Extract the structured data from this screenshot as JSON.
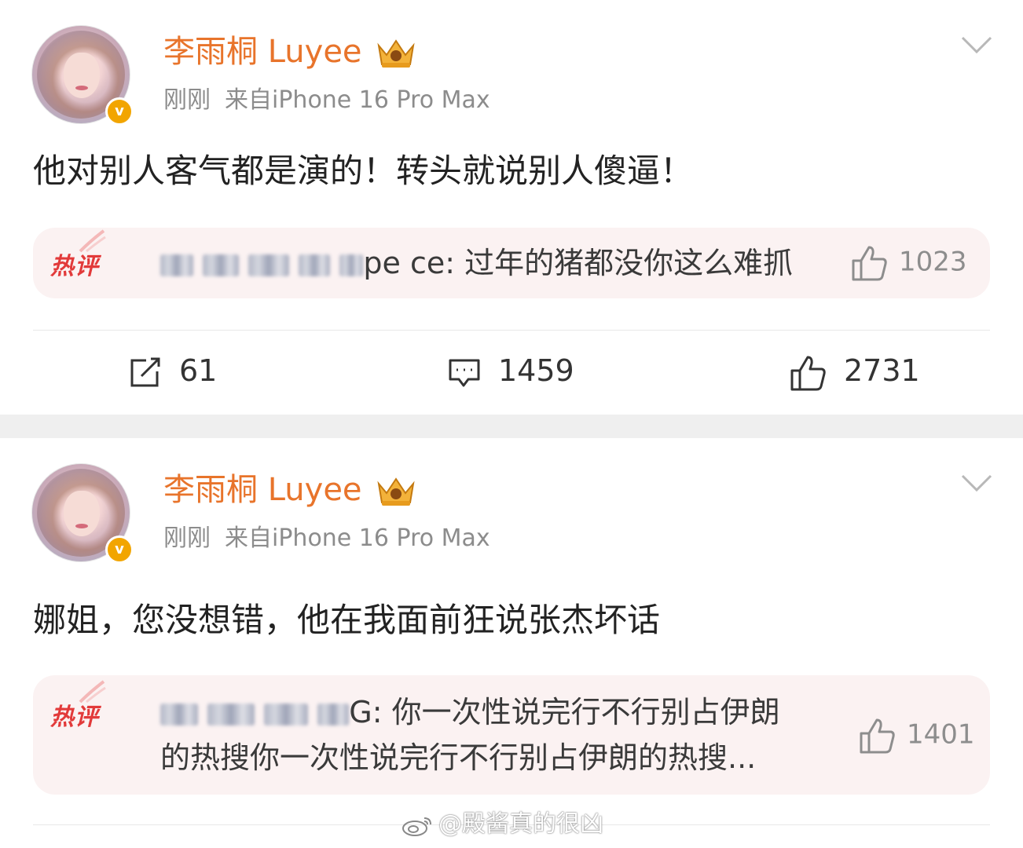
{
  "posts": [
    {
      "author": "李雨桐 Luyee",
      "time": "刚刚",
      "source": "来自iPhone 16 Pro Max",
      "text": "他对别人客气都是演的！转头就说别人傻逼！",
      "hot_comment": {
        "tag": "热评",
        "user_visible": "pe ce:",
        "text": "过年的猪都没你这么难抓",
        "likes": "1023"
      },
      "actions": {
        "reposts": "61",
        "comments": "1459",
        "likes": "2731"
      }
    },
    {
      "author": "李雨桐 Luyee",
      "time": "刚刚",
      "source": "来自iPhone 16 Pro Max",
      "text": "娜姐，您没想错，他在我面前狂说张杰坏话",
      "hot_comment": {
        "tag": "热评",
        "user_visible": "G:",
        "line1": "你一次性说完行不行别占伊朗",
        "line2": "的热搜你一次性说完行不行别占伊朗的热搜...",
        "likes": "1401"
      }
    }
  ],
  "watermark": "@殿酱真的很凶",
  "colors": {
    "name": "#e8742b",
    "hot_tag": "#e23a3a",
    "hot_bg": "#fbf2f2",
    "verified": "#f2a500"
  },
  "icons": [
    "avatar",
    "verified-badge-icon",
    "crown-icon",
    "chevron-down-icon",
    "repost-icon",
    "comment-icon",
    "thumbs-up-icon",
    "weibo-logo-icon"
  ]
}
